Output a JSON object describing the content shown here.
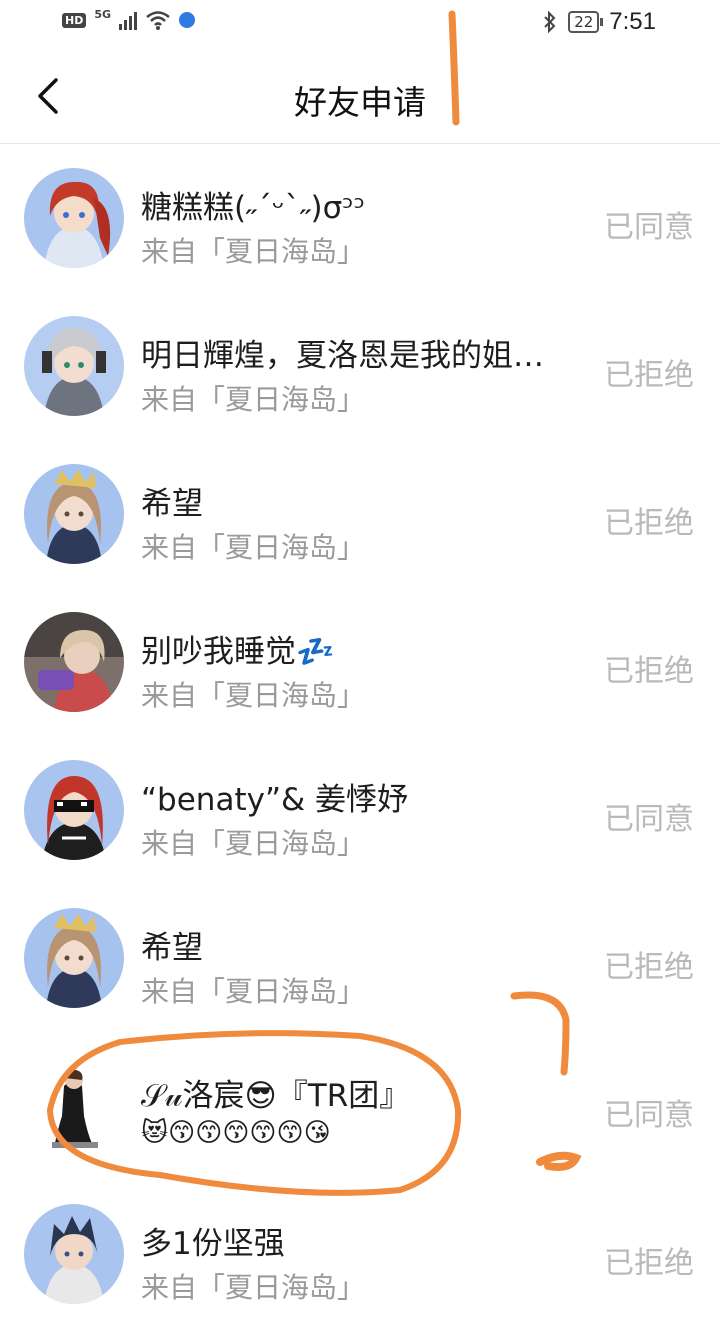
{
  "status_bar": {
    "hd": "HD",
    "network": "5G",
    "battery": "22",
    "time": "7:51"
  },
  "header": {
    "title": "好友申请"
  },
  "requests": [
    {
      "name": "糖糕糕(˶ˊᵕˋ˶)σᵓᵓ",
      "source": "来自「夏日海岛」",
      "status": "已同意"
    },
    {
      "name": "明日輝煌，夏洛恩是我的姐…",
      "source": "来自「夏日海岛」",
      "status": "已拒绝"
    },
    {
      "name": "希望",
      "source": "来自「夏日海岛」",
      "status": "已拒绝"
    },
    {
      "name": "别吵我睡觉💤",
      "source": "来自「夏日海岛」",
      "status": "已拒绝"
    },
    {
      "name": "“benaty”& 姜悸妤",
      "source": "来自「夏日海岛」",
      "status": "已同意"
    },
    {
      "name": "希望",
      "source": "来自「夏日海岛」",
      "status": "已拒绝"
    },
    {
      "name": "𝒮𝓊洛宸😎『TR团』",
      "source": "😻😙😙😙😙😙😘",
      "status": "已同意"
    },
    {
      "name": "多1份坚强",
      "source": "来自「夏日海岛」",
      "status": "已拒绝"
    }
  ],
  "colors": {
    "annotation": "#f08a3c",
    "muted_text": "#9a9a9a",
    "status_text": "#b9b9b9"
  }
}
